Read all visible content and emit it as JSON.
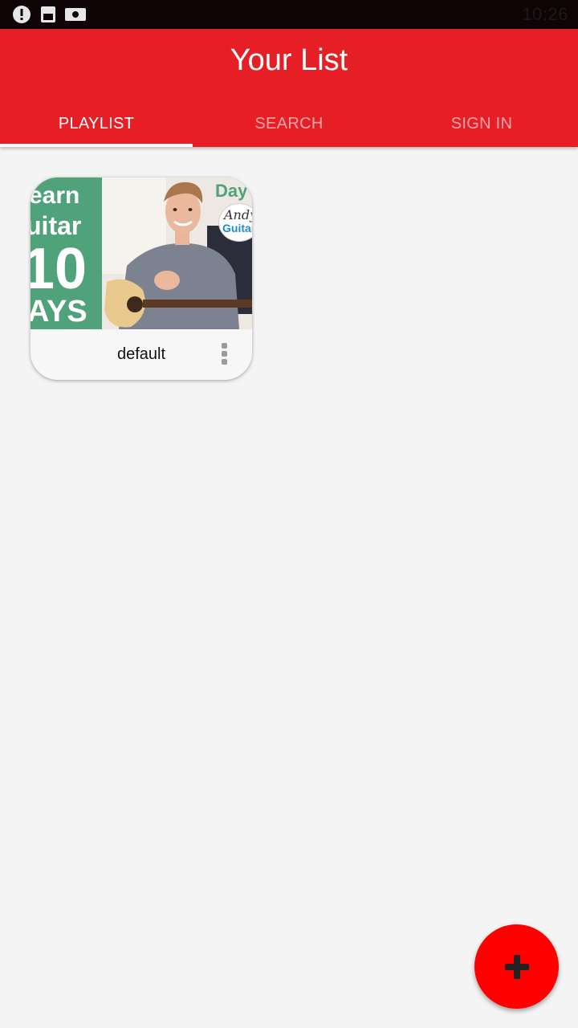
{
  "status_bar": {
    "time": "10:26",
    "icons": [
      "alert-circle-icon",
      "sim-card-icon",
      "screenshot-icon"
    ]
  },
  "header": {
    "title": "Your List",
    "tabs": [
      {
        "label": "PLAYLIST",
        "active": true
      },
      {
        "label": "SEARCH",
        "active": false
      },
      {
        "label": "SIGN IN",
        "active": false
      }
    ],
    "accent_color": "#e61f26"
  },
  "playlists": [
    {
      "title": "default",
      "thumbnail": {
        "lines": [
          "earn",
          "uitar",
          "10",
          "AYS"
        ],
        "corner_text": "Day",
        "badge_lines": [
          "Andy",
          "Guitar"
        ]
      }
    }
  ],
  "fab": {
    "icon": "plus-icon",
    "color": "#ff0000"
  }
}
